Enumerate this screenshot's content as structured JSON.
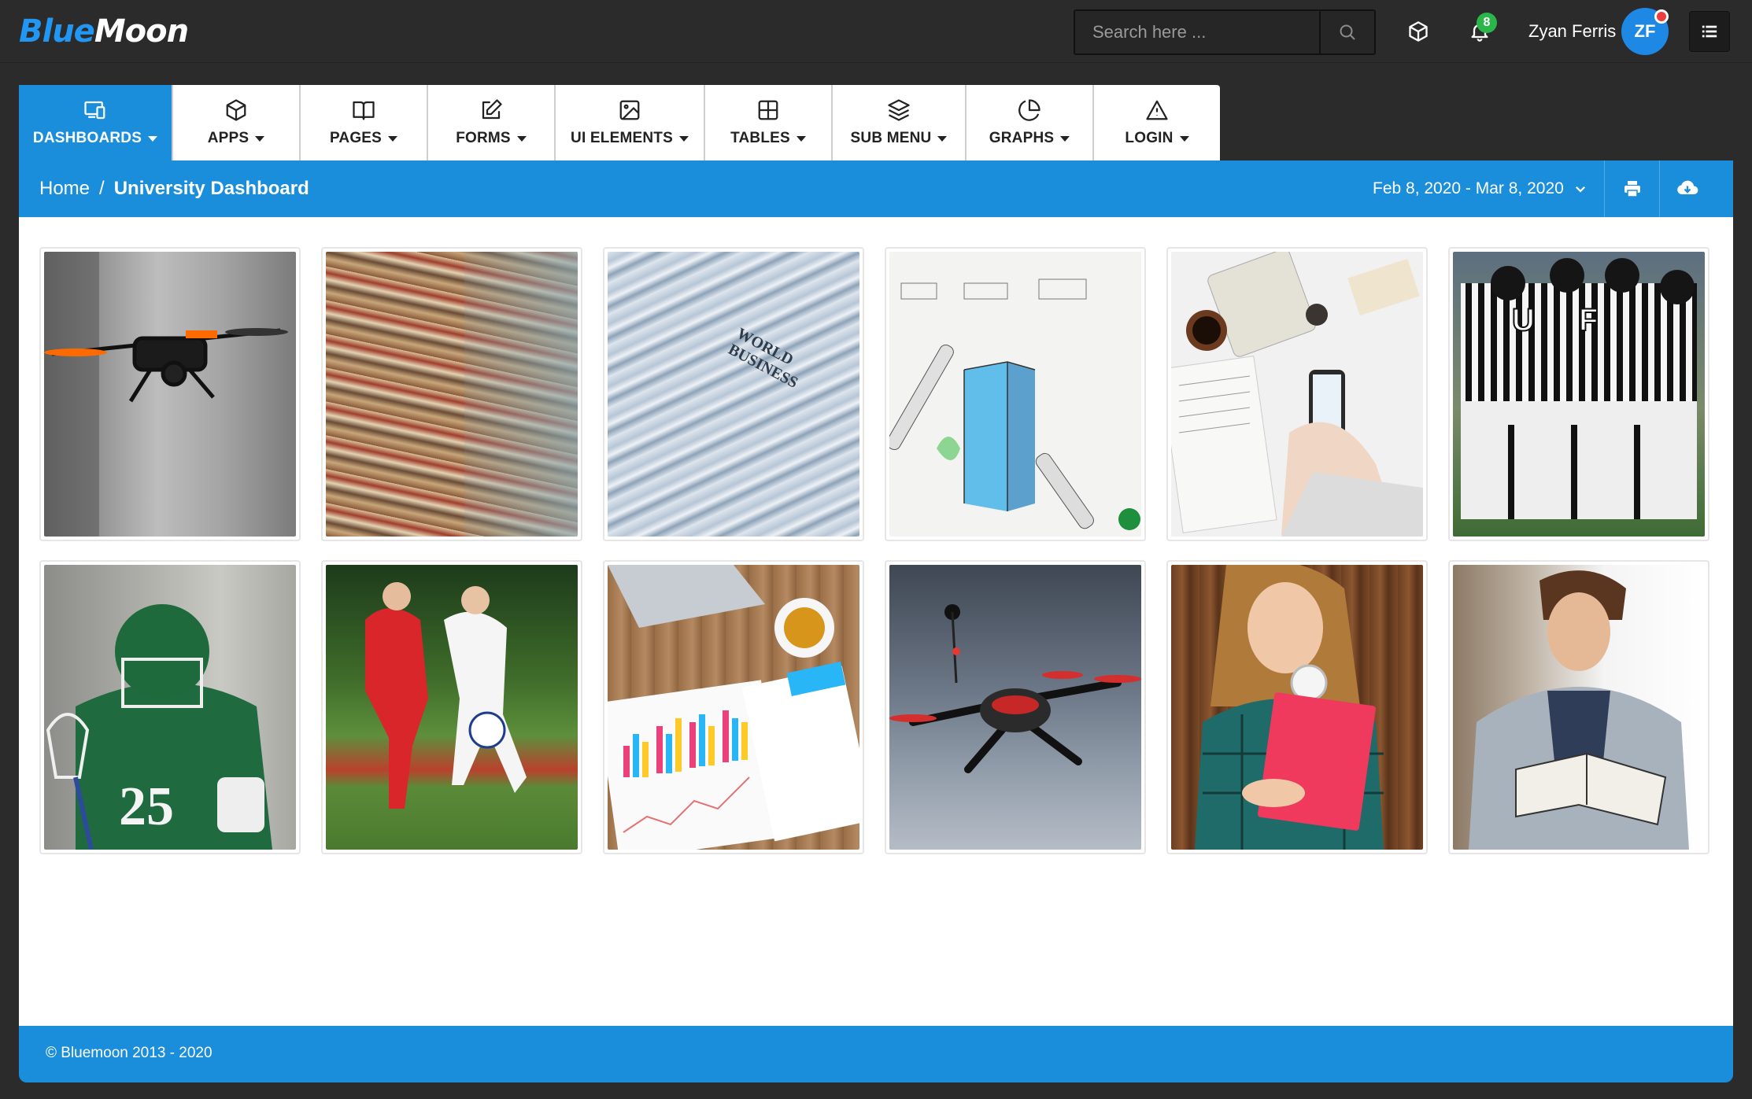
{
  "brand": {
    "logo_part1": "Blue",
    "logo_part2": "Moon"
  },
  "search": {
    "placeholder": "Search here ..."
  },
  "notifications": {
    "count": "8"
  },
  "user": {
    "name": "Zyan Ferris",
    "initials": "ZF"
  },
  "nav": {
    "tabs": [
      {
        "label": "DASHBOARDS",
        "icon": "devices-icon"
      },
      {
        "label": "APPS",
        "icon": "box-icon"
      },
      {
        "label": "PAGES",
        "icon": "book-icon"
      },
      {
        "label": "FORMS",
        "icon": "edit-icon"
      },
      {
        "label": "UI ELEMENTS",
        "icon": "image-icon"
      },
      {
        "label": "TABLES",
        "icon": "table-icon"
      },
      {
        "label": "SUB MENU",
        "icon": "layers-icon"
      },
      {
        "label": "GRAPHS",
        "icon": "pie-chart-icon"
      },
      {
        "label": "LOGIN",
        "icon": "warning-icon"
      }
    ]
  },
  "breadcrumb": {
    "home": "Home",
    "separator": "/",
    "current": "University Dashboard"
  },
  "daterange": {
    "label": "Feb 8, 2020 - Mar 8, 2020"
  },
  "gallery": {
    "photos": [
      "drone-photo",
      "books-photo",
      "newspapers-photo",
      "architecture-sketch-photo",
      "desk-calculator-photo",
      "referees-huddle-photo",
      "lacrosse-player-photo",
      "soccer-players-photo",
      "analytics-report-photo",
      "quadcopter-photo",
      "student-girl-photo",
      "student-reading-photo"
    ]
  },
  "footer": {
    "text": "© Bluemoon 2013 - 2020"
  },
  "colors": {
    "accent": "#1a8ddb",
    "topbar": "#2b2b2b",
    "badge": "#2bb64c",
    "alert": "#ef3b3b"
  }
}
